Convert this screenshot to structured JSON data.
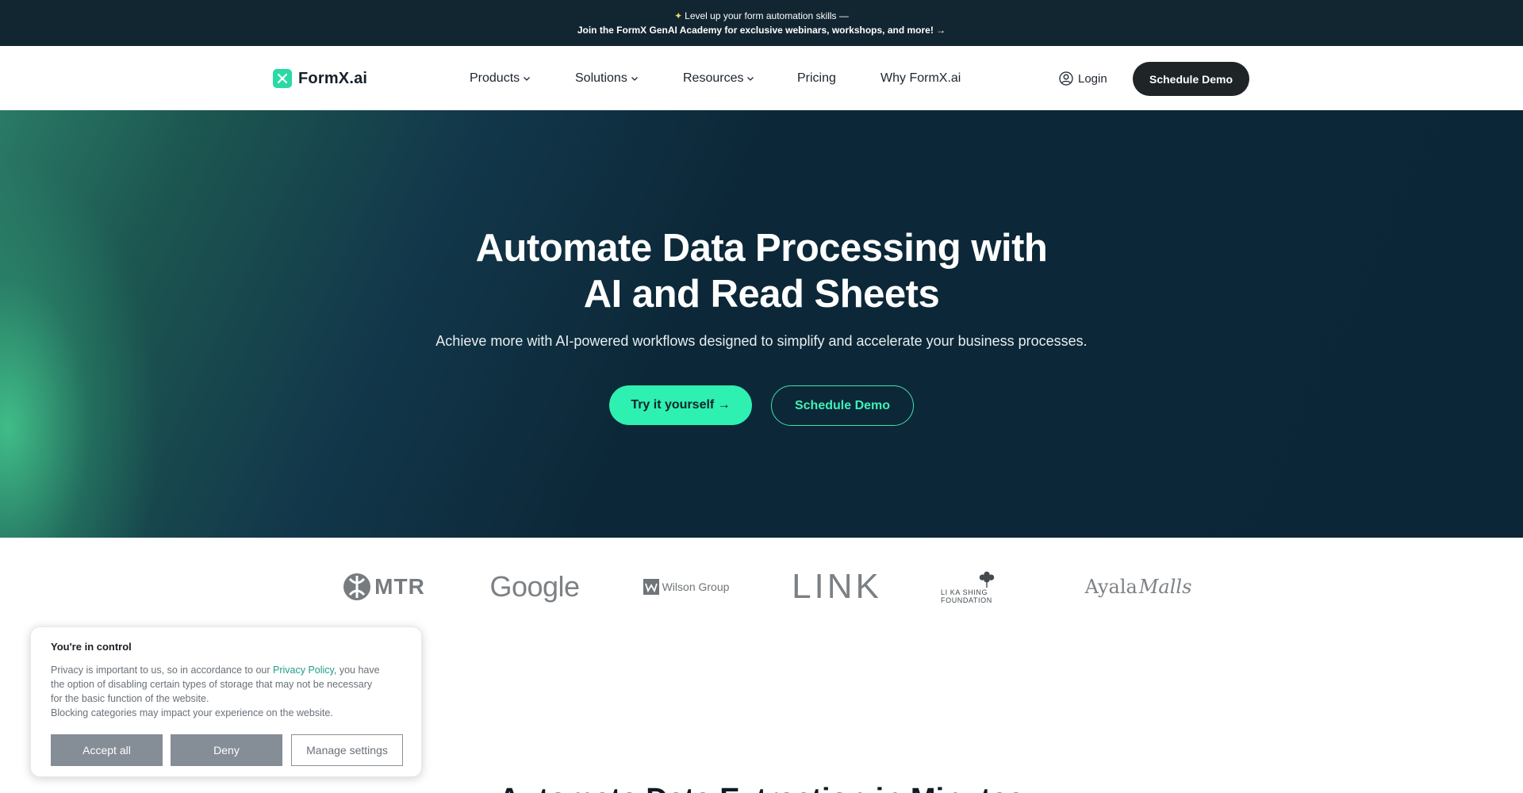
{
  "announcement": {
    "line1": "Level up your form automation skills —",
    "line2": "Join the FormX GenAI Academy for exclusive webinars, workshops, and more! →",
    "icon": "sparkle-icon"
  },
  "nav": {
    "logo_text": "FormX.ai",
    "items": [
      {
        "label": "Products",
        "has_dropdown": true
      },
      {
        "label": "Solutions",
        "has_dropdown": true
      },
      {
        "label": "Resources",
        "has_dropdown": true
      },
      {
        "label": "Pricing",
        "has_dropdown": false
      },
      {
        "label": "Why FormX.ai",
        "has_dropdown": false
      }
    ],
    "login_label": "Login",
    "demo_label": "Schedule Demo"
  },
  "hero": {
    "title_line1": "Automate Data Processing with",
    "title_line2": "AI and Read Sheets",
    "subtitle": "Achieve more with AI-powered workflows designed to simplify and accelerate your business processes.",
    "primary_label": "Try it yourself →",
    "secondary_label": "Schedule Demo"
  },
  "logos": {
    "mtr": "MTR",
    "google": "Google",
    "wilson": "Wilson Group",
    "link": "LINK",
    "lks": "LI KA SHING FOUNDATION",
    "ayala": "Ayala",
    "ayala_script": "Malls"
  },
  "next_section": {
    "heading": "Automate Data Extraction in Minutes"
  },
  "cookie": {
    "title": "You're in control",
    "text_before_link": "Privacy is important to us, so in accordance to our ",
    "link_text": "Privacy Policy",
    "text_after_link": ", you have the option of disabling certain types of storage that may not be necessary for the basic function of the website.",
    "text_line2": "Blocking categories may impact your experience on the website.",
    "accept_label": "Accept all",
    "deny_label": "Deny",
    "manage_label": "Manage settings"
  },
  "colors": {
    "accent": "#2ef0b0",
    "dark_bar": "#122631",
    "hero_bg": "#0b2636",
    "demo_button": "#1f2426",
    "cookie_button": "#858d96"
  }
}
